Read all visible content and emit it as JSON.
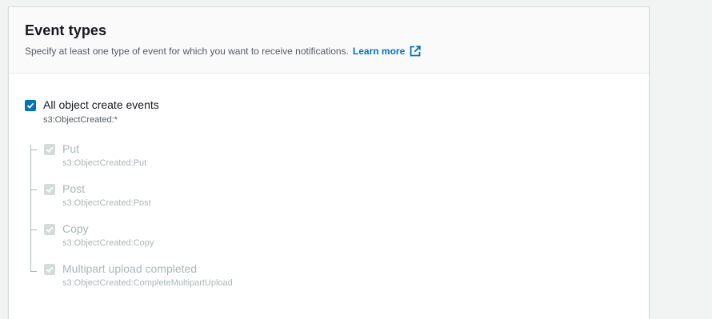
{
  "section": {
    "title": "Event types",
    "description": "Specify at least one type of event for which you want to receive notifications.",
    "learn_more": "Learn more"
  },
  "parent_event": {
    "label": "All object create events",
    "code": "s3:ObjectCreated:*",
    "checked": true
  },
  "child_events": [
    {
      "label": "Put",
      "code": "s3:ObjectCreated:Put",
      "checked": true,
      "disabled": true
    },
    {
      "label": "Post",
      "code": "s3:ObjectCreated:Post",
      "checked": true,
      "disabled": true
    },
    {
      "label": "Copy",
      "code": "s3:ObjectCreated:Copy",
      "checked": true,
      "disabled": true
    },
    {
      "label": "Multipart upload completed",
      "code": "s3:ObjectCreated:CompleteMultipartUpload",
      "checked": true,
      "disabled": true
    }
  ],
  "colors": {
    "accent": "#0073bb",
    "disabled": "#aab7b8",
    "background": "#f2f3f3"
  }
}
